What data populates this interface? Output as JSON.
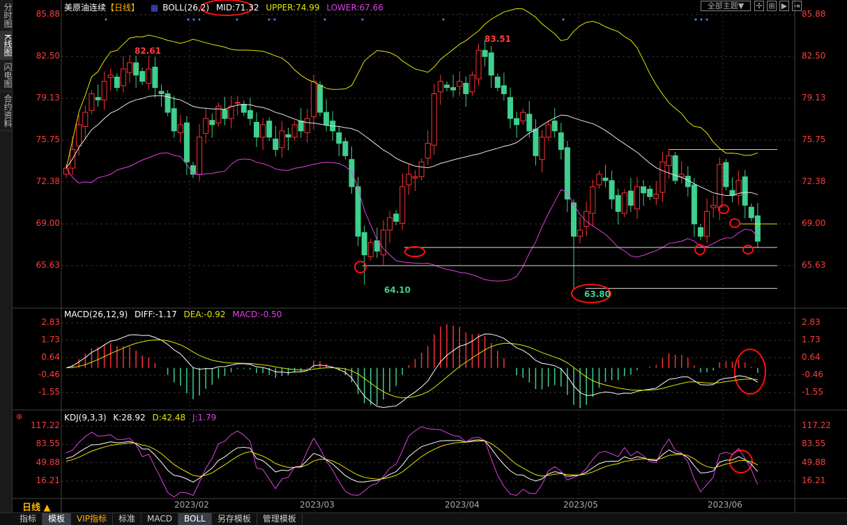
{
  "sidebar": {
    "items": [
      "分时图",
      "K线图",
      "闪电图",
      "合约资料"
    ],
    "active": 1
  },
  "header": {
    "symbol": "美原油连续",
    "period": "【日线】",
    "boll": "BOLL(26,2)",
    "mid": "MID:71.32",
    "upper": "UPPER:74.99",
    "lower": "LOWER:67.66"
  },
  "toolbar": {
    "theme": "全部主题▼",
    "btn1": "✢",
    "btn2": "⊞",
    "btn3": "▶",
    "btn4": "⇥"
  },
  "macd_legend": {
    "name": "MACD(26,12,9)",
    "diff": "DIFF:-1.17",
    "dea": "DEA:-0.92",
    "macd": "MACD:-0.50"
  },
  "kdj_legend": {
    "name": "KDJ(9,3,3)",
    "k": "K:28.92",
    "d": "D:42.48",
    "j": "J:1.79"
  },
  "axes": {
    "main": [
      "85.88",
      "82.50",
      "79.13",
      "75.75",
      "72.38",
      "69.00",
      "65.63"
    ],
    "macd": [
      "2.83",
      "1.73",
      "0.64",
      "-0.46",
      "-1.55"
    ],
    "kdj": [
      "117.22",
      "83.55",
      "49.88",
      "16.21"
    ]
  },
  "dates": [
    "2023/02",
    "2023/03",
    "2023/04",
    "2023/05",
    "2023/06"
  ],
  "annotations": {
    "high1": "82.61",
    "high2": "83.51",
    "low1": "64.10",
    "low2": "63.80"
  },
  "period_label": "日线 ▲",
  "tabs": [
    "指标",
    "模板",
    "VIP指标",
    "标准",
    "MACD",
    "BOLL",
    "另存模板",
    "管理模板"
  ],
  "colors": {
    "up": "#ff3232",
    "down": "#3fcf8e",
    "mid": "#e8e8e8",
    "upper": "#e6e600",
    "lower": "#e040e0",
    "axis": "#ff3c3c"
  },
  "chart_data": {
    "type": "candlestick",
    "closes": [
      73.5,
      75,
      77,
      78,
      79.5,
      79,
      80.5,
      81,
      80,
      81.5,
      82,
      81,
      80.5,
      81.5,
      80,
      79.5,
      78,
      76.5,
      77,
      74,
      73,
      76,
      77.5,
      77,
      78.5,
      77.5,
      78.5,
      78.8,
      78,
      77.5,
      76,
      77,
      76,
      75,
      76.5,
      76,
      77,
      76.5,
      77.5,
      80.5,
      78,
      77,
      76.5,
      75.5,
      74.5,
      72,
      68,
      66.5,
      67.5,
      66.8,
      68.5,
      69.5,
      69.2,
      72,
      73,
      72.8,
      74,
      75.5,
      79.5,
      80.5,
      80,
      79.8,
      80.5,
      79.5,
      81,
      83,
      82.5,
      81,
      80,
      79.5,
      77.5,
      77,
      78,
      76.5,
      74.5,
      76,
      77,
      76.5,
      75,
      71,
      68,
      68.5,
      70,
      72,
      73,
      72.5,
      71,
      70,
      71.5,
      70.5,
      72,
      71.5,
      71.2,
      71.4,
      74,
      74.5,
      72.5,
      73,
      72,
      69,
      68,
      70,
      70.5,
      73.8,
      72,
      71.3,
      72.5,
      70.5,
      69.5,
      67.6
    ],
    "special": {
      "10": {
        "high": 82.61
      },
      "65": {
        "high": 83.51
      },
      "47": {
        "low": 64.1
      },
      "80": {
        "low": 63.8
      }
    },
    "hlines": [
      {
        "price": 75.0,
        "color": "yellow"
      },
      {
        "price": 69.0,
        "color": "yellow"
      },
      {
        "price": 67.1,
        "color": "white"
      },
      {
        "price": 65.63,
        "color": "white"
      },
      {
        "price": 63.8,
        "color": "white"
      }
    ],
    "indicators": [
      "BOLL(26,2)",
      "MACD(26,12,9)",
      "KDJ(9,3,3)"
    ]
  }
}
